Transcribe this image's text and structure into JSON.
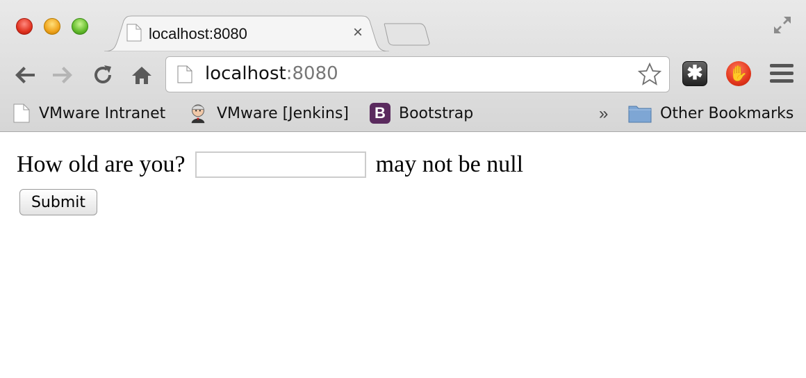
{
  "tab": {
    "title": "localhost:8080",
    "close": "×"
  },
  "omnibox": {
    "host": "localhost",
    "port": ":8080"
  },
  "bookmarks": [
    {
      "label": "VMware Intranet",
      "icon": "page-icon"
    },
    {
      "label": "VMware [Jenkins]",
      "icon": "jenkins-icon"
    },
    {
      "label": "Bootstrap",
      "icon": "bootstrap-icon",
      "icon_text": "B"
    }
  ],
  "bookmarks_overflow": "»",
  "other_bookmarks": "Other Bookmarks",
  "form": {
    "question": "How old are you?",
    "age_value": "",
    "error": "may not be null",
    "submit_label": "Submit"
  }
}
